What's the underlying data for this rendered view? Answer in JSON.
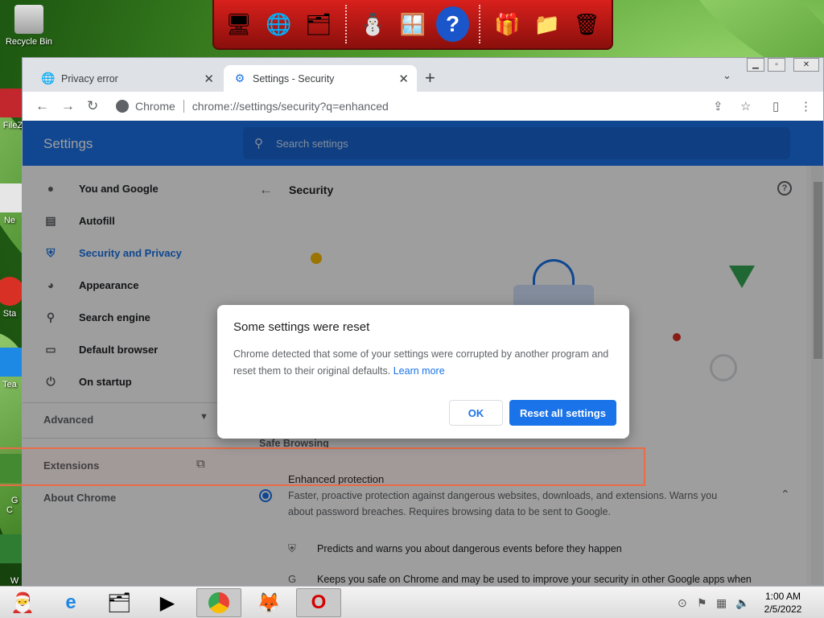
{
  "desktop": {
    "icons": [
      {
        "label": "Recycle Bin"
      },
      {
        "label": "FileZ"
      },
      {
        "label": "Ne"
      },
      {
        "label": "Sta"
      },
      {
        "label": "Tea"
      },
      {
        "label": "G\nC"
      },
      {
        "label": "W\nL"
      }
    ]
  },
  "browser": {
    "tabs": [
      {
        "label": "Privacy error",
        "icon": "globe-icon"
      },
      {
        "label": "Settings - Security",
        "icon": "gear-icon"
      }
    ],
    "address": {
      "scheme": "Chrome",
      "url": "chrome://settings/security?q=enhanced"
    }
  },
  "settings": {
    "title": "Settings",
    "search_placeholder": "Search settings",
    "nav": [
      {
        "label": "You and Google",
        "icon": "person-icon"
      },
      {
        "label": "Autofill",
        "icon": "clipboard-icon"
      },
      {
        "label": "Security and Privacy",
        "icon": "shield-icon"
      },
      {
        "label": "Appearance",
        "icon": "palette-icon"
      },
      {
        "label": "Search engine",
        "icon": "search-icon"
      },
      {
        "label": "Default browser",
        "icon": "browser-icon"
      },
      {
        "label": "On startup",
        "icon": "power-icon"
      }
    ],
    "advanced": "Advanced",
    "extensions": "Extensions",
    "about": "About Chrome",
    "section_title": "Security",
    "safe_browsing": "Safe Browsing",
    "enhanced_title": "Enhanced protection",
    "enhanced_desc": "Faster, proactive protection against dangerous websites, downloads, and extensions. Warns you about password breaches. Requires browsing data to be sent to Google.",
    "sub_items": [
      "Predicts and warns you about dangerous events before they happen",
      "Keeps you safe on Chrome and may be used to improve your security in other Google apps when"
    ]
  },
  "dialog": {
    "title": "Some settings were reset",
    "body": "Chrome detected that some of your settings were corrupted by another program and reset them to their original defaults.",
    "link": "Learn more",
    "ok": "OK",
    "reset": "Reset all settings"
  },
  "taskbar": {
    "time": "1:00 AM",
    "date": "2/5/2022"
  },
  "colors": {
    "accent": "#1a73e8",
    "highlight": "#ea6b47"
  }
}
